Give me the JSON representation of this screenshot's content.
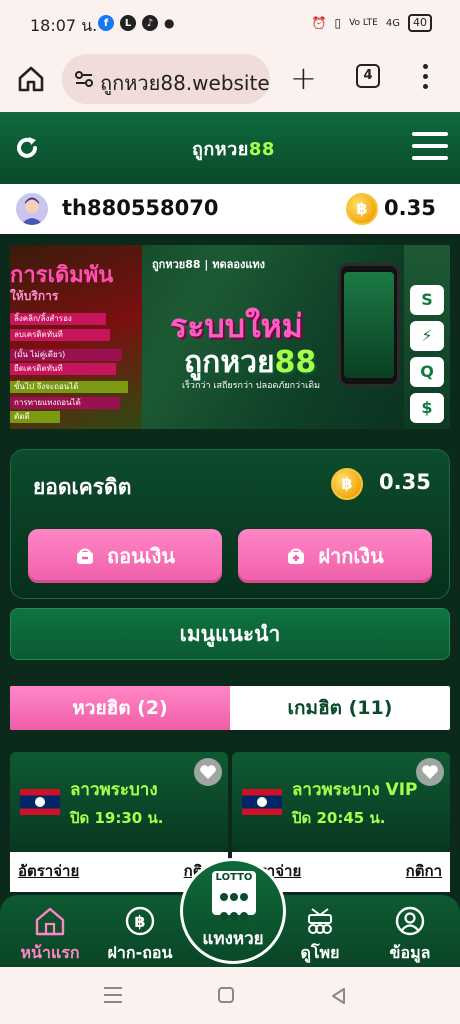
{
  "statusbar": {
    "time": "18:07 น.",
    "battery": "40",
    "signal_labels": [
      "Vo LTE",
      "4G"
    ]
  },
  "browser": {
    "url": "ถูกหวย88.website",
    "tab_count": "4"
  },
  "header": {
    "logo_text": "ถูกหวย",
    "logo_num": "88"
  },
  "user": {
    "username": "th880558070",
    "coin_symbol": "฿",
    "balance": "0.35"
  },
  "banner": {
    "left_line1": "การเดิมพัน",
    "left_line2": "ให้บริการ",
    "left_bars": [
      "ลิ้งคลิก/ลิ้งสำรอง",
      "ลบเครดิตทันที",
      "(มั้น ไม่คู่เดียว)",
      "ยืดเครดิตทันที",
      "ขั้นไป จึงจะถอนได้",
      "การทายแทงถอนได้",
      "ตัดดี"
    ],
    "brand": "ถูกหวย88",
    "brand_sub": "ทดลองแทง",
    "title1": "ระบบใหม่",
    "title2_text": "ถูกหวย",
    "title2_num": "88",
    "subtitle": "เร็วกว่า เสถียรกว่า ปลอดภัยกว่าเดิม",
    "right_tiles": [
      "S",
      "⚡",
      "Q",
      "$"
    ]
  },
  "credit": {
    "label": "ยอดเครดิต",
    "coin_symbol": "฿",
    "value": "0.35",
    "withdraw_label": "ถอนเงิน",
    "deposit_label": "ฝากเงิน"
  },
  "menu_recommend": "เมนูแนะนำ",
  "tabs": {
    "lottery_hot": "หวยฮิต (2)",
    "games_hot": "เกมฮิต (11)"
  },
  "lotteries": [
    {
      "name": "ลาวพระบาง",
      "close": "ปิด 19:30 น.",
      "rate_label": "อัตราจ่าย",
      "rules_label": "กติกา"
    },
    {
      "name": "ลาวพระบาง VIP",
      "close": "ปิด 20:45 น.",
      "rate_label": "อัตราจ่าย",
      "rules_label": "กติกา"
    }
  ],
  "bottom_nav": {
    "home": "หน้าแรก",
    "deposit_withdraw": "ฝาก-ถอน",
    "center_badge": "LOTTO",
    "center": "แทงหวย",
    "results": "ดูโพย",
    "profile": "ข้อมูล"
  },
  "colors": {
    "brand_green": "#0b4a2a",
    "accent_lime": "#a6ff4a",
    "accent_pink": "#ef5fa9",
    "coin_gold": "#f3a712"
  }
}
